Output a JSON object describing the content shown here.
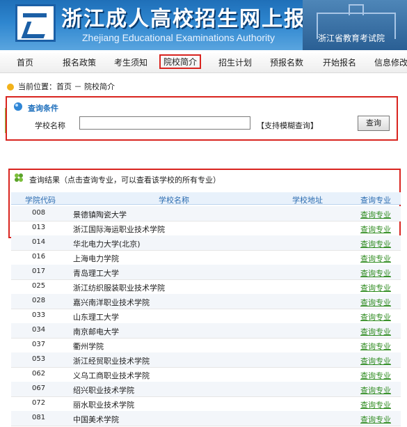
{
  "header": {
    "title": "浙江成人高校招生网上报名",
    "subtitle": "Zhejiang Educational Examinations Authority",
    "org": "浙江省教育考试院"
  },
  "nav": {
    "items": [
      {
        "label": "首页"
      },
      {
        "label": "报名政策"
      },
      {
        "label": "考生须知"
      },
      {
        "label": "院校简介"
      },
      {
        "label": "招生计划"
      },
      {
        "label": "预报名数"
      },
      {
        "label": "开始报名"
      },
      {
        "label": "信息修改"
      }
    ],
    "active_index": 3
  },
  "breadcrumb": {
    "prefix": "当前位置：首页 － 院校简介"
  },
  "query": {
    "title": "查询条件",
    "school_label": "学校名称",
    "school_value": "",
    "hint": "【支持模糊查询】",
    "button": "查询"
  },
  "results": {
    "title": "查询结果（点击查询专业，可以查看该学校的所有专业）",
    "columns": [
      "学院代码",
      "学校名称",
      "学校地址",
      "查询专业"
    ],
    "rows": [
      {
        "code": "008",
        "name": "景德镇陶瓷大学",
        "link": "查询专业"
      },
      {
        "code": "013",
        "name": "浙江国际海运职业技术学院",
        "link": "查询专业"
      },
      {
        "code": "014",
        "name": "华北电力大学(北京)",
        "link": "查询专业"
      },
      {
        "code": "016",
        "name": "上海电力学院",
        "link": "查询专业"
      },
      {
        "code": "017",
        "name": "青岛理工大学",
        "link": "查询专业"
      },
      {
        "code": "025",
        "name": "浙江纺织服装职业技术学院",
        "link": "查询专业"
      },
      {
        "code": "028",
        "name": "嘉兴南洋职业技术学院",
        "link": "查询专业"
      },
      {
        "code": "033",
        "name": "山东理工大学",
        "link": "查询专业"
      },
      {
        "code": "034",
        "name": "南京邮电大学",
        "link": "查询专业"
      },
      {
        "code": "037",
        "name": "衢州学院",
        "link": "查询专业"
      },
      {
        "code": "053",
        "name": "浙江经贸职业技术学院",
        "link": "查询专业"
      },
      {
        "code": "062",
        "name": "义乌工商职业技术学院",
        "link": "查询专业"
      },
      {
        "code": "067",
        "name": "绍兴职业技术学院",
        "link": "查询专业"
      },
      {
        "code": "072",
        "name": "丽水职业技术学院",
        "link": "查询专业"
      },
      {
        "code": "081",
        "name": "中国美术学院",
        "link": "查询专业"
      }
    ]
  },
  "colors": {
    "accent_blue": "#1e6fbc",
    "highlight_red": "#d9241f",
    "link_green": "#2e8b1f"
  }
}
